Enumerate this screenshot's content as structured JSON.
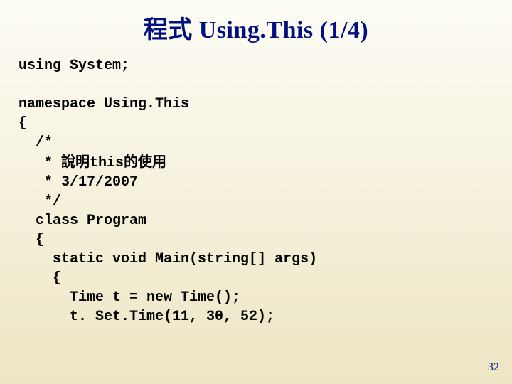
{
  "title": {
    "cjk": "程式",
    "rest": " Using.This (1/4)"
  },
  "code": {
    "l00": "using System;",
    "l01": "",
    "l02": "namespace Using.This",
    "l03": "{",
    "l04": "  /*",
    "l05a": "   * ",
    "l05b_cjk": "說明",
    "l05c": "this",
    "l05d_cjk": "的使用",
    "l06": "   * 3/17/2007",
    "l07": "   */",
    "l08": "  class Program",
    "l09": "  {",
    "l10": "    static void Main(string[] args)",
    "l11": "    {",
    "l12": "      Time t = new Time();",
    "l13": "      t. Set.Time(11, 30, 52);"
  },
  "page_number": "32"
}
